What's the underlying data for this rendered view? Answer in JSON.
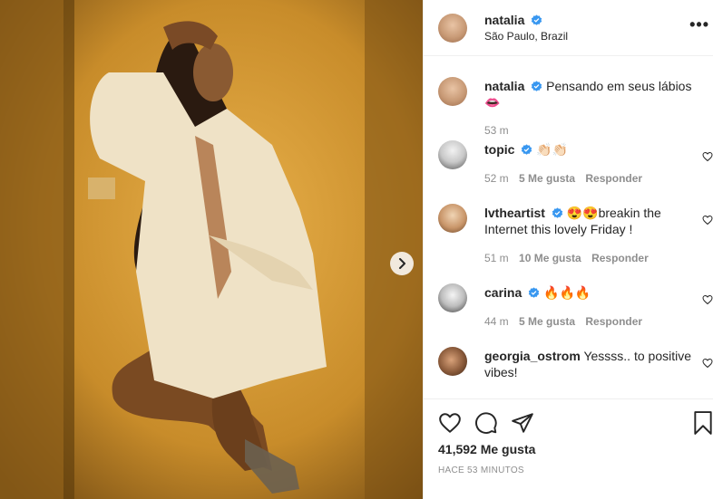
{
  "post": {
    "author": "natalia",
    "location": "São Paulo, Brazil",
    "caption": "Pensando em seus lábios 👄",
    "caption_time": "53 m",
    "likes": "41,592 Me gusta",
    "timestamp": "HACE 53 MINUTOS"
  },
  "comments": [
    {
      "user": "topic",
      "text": "👏🏻👏🏻",
      "time": "52 m",
      "likes": "5 Me gusta",
      "reply": "Responder"
    },
    {
      "user": "lvtheartist",
      "text": "😍😍breakin the Internet this lovely Friday !",
      "time": "51 m",
      "likes": "10 Me gusta",
      "reply": "Responder"
    },
    {
      "user": "carina",
      "text": "🔥🔥🔥",
      "time": "44 m",
      "likes": "5 Me gusta",
      "reply": "Responder"
    },
    {
      "user": "georgia_ostrom",
      "text": "Yessss.. to positive vibes!",
      "time": "",
      "likes": "",
      "reply": ""
    }
  ],
  "icons": {
    "next": "chevron-right-icon",
    "more": "more-options-icon",
    "like": "heart-icon",
    "comment": "comment-icon",
    "share": "share-icon",
    "save": "bookmark-icon",
    "verified": "verified-badge-icon"
  },
  "colors": {
    "verified": "#3897f0",
    "muted": "#8e8e8e",
    "text": "#262626"
  }
}
